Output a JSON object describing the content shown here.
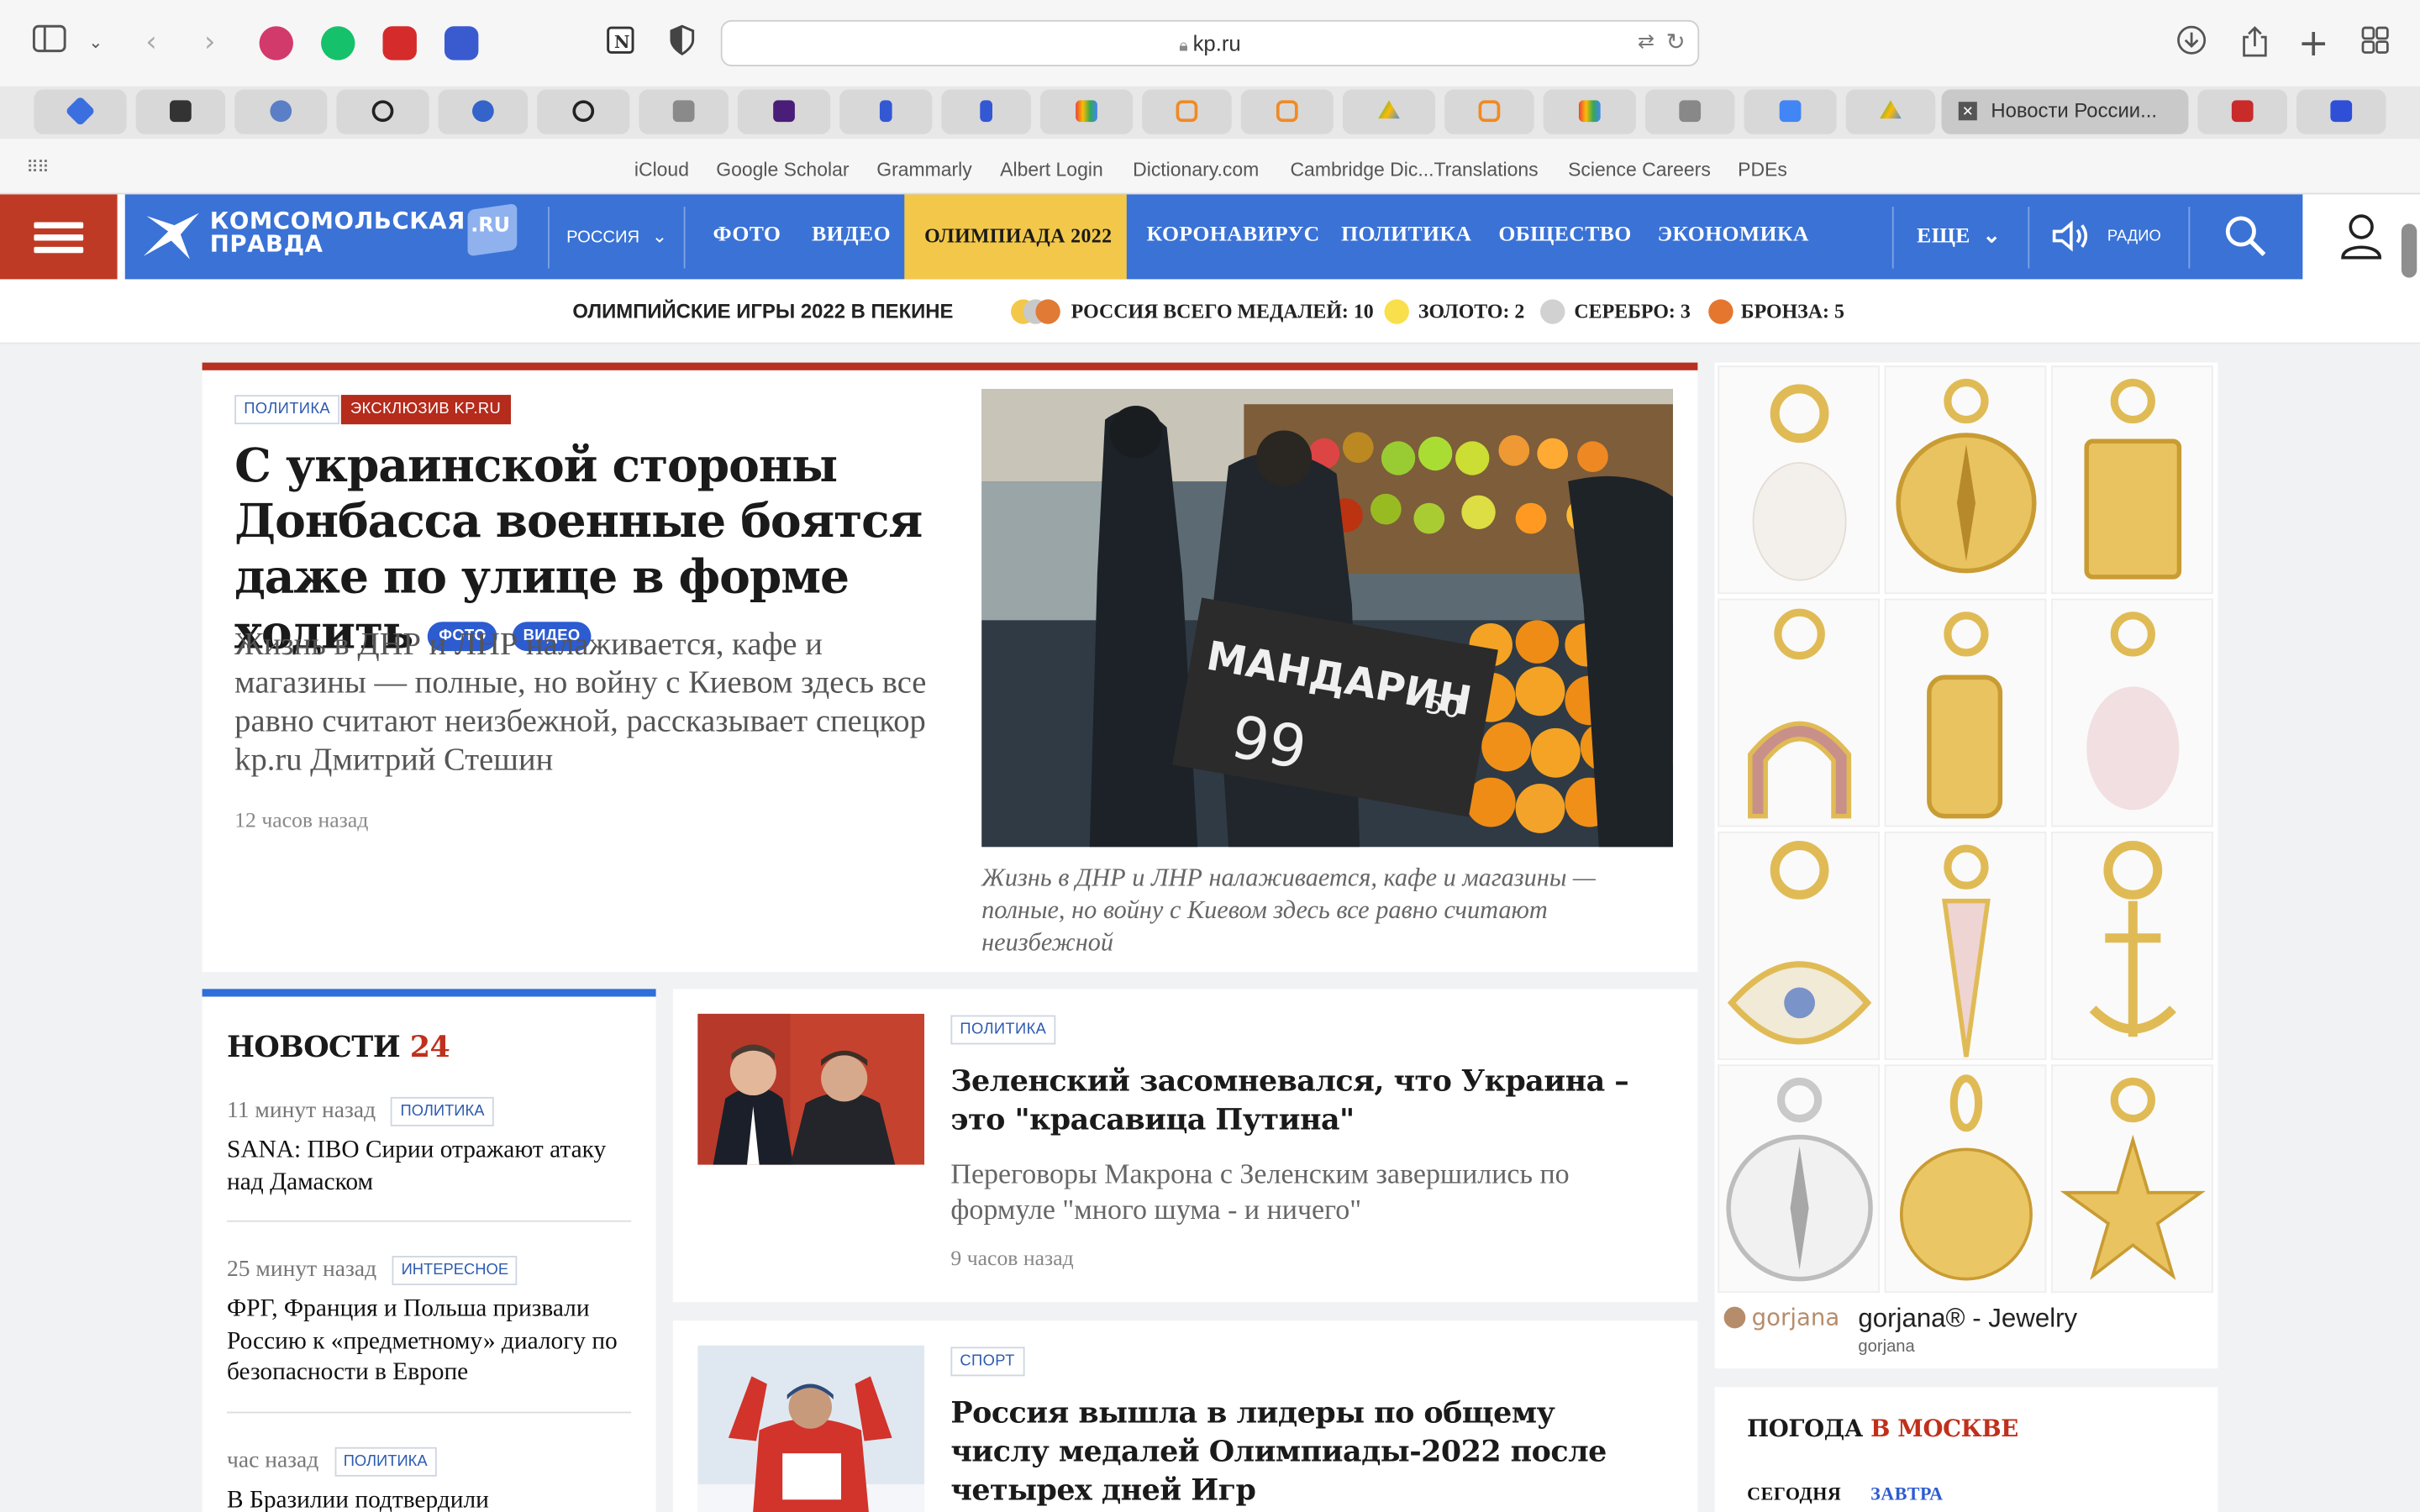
{
  "browser": {
    "url": "kp.ru",
    "active_tab_title": "Новости России...",
    "bookmarks": [
      "iCloud",
      "Google Scholar",
      "Grammarly",
      "Albert Login",
      "Dictionary.com",
      "Cambridge Dic...Translations",
      "Science Careers",
      "PDEs"
    ]
  },
  "site": {
    "logo_line1": "КОМСОМОЛЬСКАЯ",
    "logo_line2": "ПРАВДА",
    "logo_ru": ".RU",
    "region": "РОССИЯ",
    "nav": [
      "ФОТО",
      "ВИДЕО",
      "ОЛИМПИАДА 2022",
      "КОРОНАВИРУС",
      "ПОЛИТИКА",
      "ОБЩЕСТВО",
      "ЭКОНОМИКА"
    ],
    "more": "ЕЩЕ",
    "radio": "РАДИО",
    "accent_red": "#bf3a25",
    "accent_blue": "#3a72d6",
    "accent_yellow": "#f3c84a"
  },
  "olympics": {
    "title": "ОЛИМПИЙСКИЕ ИГРЫ 2022 В ПЕКИНЕ",
    "total": "РОССИЯ ВСЕГО МЕДАЛЕЙ: 10",
    "gold": "ЗОЛОТО: 2",
    "silver": "СЕРЕБРО: 3",
    "bronze": "БРОНЗА: 5"
  },
  "lead": {
    "tag1": "ПОЛИТИКА",
    "tag2": "ЭКСКЛЮЗИВ KP.RU",
    "title": "С украинской стороны Донбасса военные боятся даже по улице в форме ходить",
    "pill_photo": "ФОТО",
    "pill_video": "ВИДЕО",
    "subtitle": "Жизнь в ДНР и ЛНР налаживается, кафе и магазины — полные, но войну с Киевом здесь все равно считают неизбежной, рассказывает спецкор kp.ru Дмитрий Стешин",
    "time": "12 часов назад",
    "caption": "Жизнь в ДНР и ЛНР налаживается, кафе и магазины — полные, но войну с Киевом здесь все равно считают неизбежной",
    "sign_text": "МАНДАРИН",
    "sign_price": "99",
    "sign_num": "50"
  },
  "news24": {
    "title": "НОВОСТИ",
    "num": "24",
    "items": [
      {
        "time": "11 минут назад",
        "tag": "ПОЛИТИКА",
        "head": "SANA: ПВО Сирии отражают атаку над Дамаском"
      },
      {
        "time": "25 минут назад",
        "tag": "ИНТЕРЕСНОЕ",
        "head": "ФРГ, Франция и Польша призвали Россию к «предметному» диалогу по безопасности в Европе"
      },
      {
        "time": "час назад",
        "tag": "ПОЛИТИКА",
        "head": "В Бразилии подтвердили"
      }
    ]
  },
  "cards": [
    {
      "tag": "ПОЛИТИКА",
      "title": "Зеленский засомневался, что Украина – это \"красавица Путина\"",
      "sub": "Переговоры Макрона с Зеленским завершились по формуле \"много шума - и ничего\"",
      "time": "9 часов назад"
    },
    {
      "tag": "СПОРТ",
      "title": "Россия вышла в лидеры по общему числу медалей Олимпиады-2022 после четырех дней Игр",
      "sub": "",
      "time": ""
    }
  ],
  "ad": {
    "brand": "gorjana",
    "title": "gorjana® - Jewelry",
    "sub": "gorjana"
  },
  "weather": {
    "title": "ПОГОДА",
    "city": "В МОСКВЕ",
    "today": "СЕГОДНЯ",
    "tomorrow": "ЗАВТРА"
  }
}
